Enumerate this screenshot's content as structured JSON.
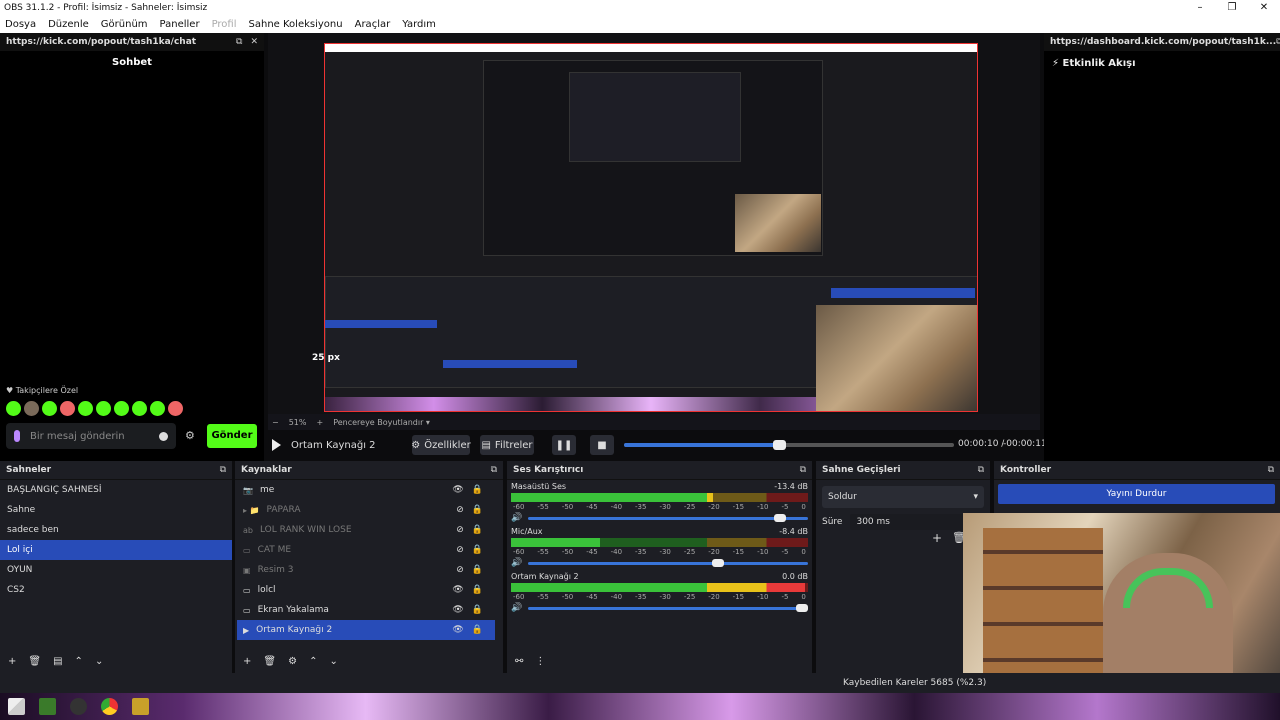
{
  "window": {
    "title": "OBS 31.1.2 - Profil: İsimsiz - Sahneler: İsimsiz"
  },
  "menu": [
    "Dosya",
    "Düzenle",
    "Görünüm",
    "Paneller",
    "Profil",
    "Sahne Koleksiyonu",
    "Araçlar",
    "Yardım"
  ],
  "chat_dock": {
    "url": "https://kick.com/popout/tash1ka/chat",
    "title": "Sohbet",
    "subs_label": "Takipçilere Özel",
    "input_placeholder": "Bir mesaj gönderin",
    "send_label": "Gönder"
  },
  "activity_dock": {
    "url": "https://dashboard.kick.com/popout/tash1k...",
    "title": "Etkinlik Akışı"
  },
  "preview": {
    "size_label": "25 px",
    "zoom": "51%",
    "fit_label": "Pencereye Boyutlandır"
  },
  "media": {
    "source_name": "Ortam Kaynağı 2",
    "properties_label": "Özellikler",
    "filters_label": "Filtreler",
    "progress": 0.47,
    "time_current": "00:00:10",
    "time_sep": "/",
    "time_remaining": "-00:00:11"
  },
  "scenes": {
    "title": "Sahneler",
    "items": [
      "BAŞLANGIÇ SAHNESİ",
      "Sahne",
      "sadece ben",
      "Lol içi",
      "OYUN",
      "CS2"
    ],
    "selected": 3
  },
  "sources": {
    "title": "Kaynaklar",
    "items": [
      {
        "name": "me",
        "icon": "camera-icon",
        "visible": true,
        "dim": false
      },
      {
        "name": "PAPARA",
        "icon": "folder-icon",
        "visible": false,
        "dim": true
      },
      {
        "name": "LOL RANK WIN LOSE",
        "icon": "text-icon",
        "visible": false,
        "dim": true
      },
      {
        "name": "CAT ME",
        "icon": "window-icon",
        "visible": false,
        "dim": true
      },
      {
        "name": "Resim 3",
        "icon": "image-icon",
        "visible": false,
        "dim": true
      },
      {
        "name": "lolcl",
        "icon": "window-icon",
        "visible": true,
        "dim": false
      },
      {
        "name": "Ekran Yakalama",
        "icon": "monitor-icon",
        "visible": true,
        "dim": false
      },
      {
        "name": "Ortam Kaynağı 2",
        "icon": "play-icon",
        "visible": true,
        "dim": false
      }
    ],
    "selected": 7
  },
  "mixer": {
    "title": "Ses Karıştırıcı",
    "ticks": [
      "-60",
      "-55",
      "-50",
      "-45",
      "-40",
      "-35",
      "-30",
      "-25",
      "-20",
      "-15",
      "-10",
      "-5",
      "0"
    ],
    "tracks": [
      {
        "name": "Masaüstü Ses",
        "db": "-13.4 dB",
        "level": 0.68,
        "volume": 0.92
      },
      {
        "name": "Mic/Aux",
        "db": "-8.4 dB",
        "level": 0.3,
        "volume": 0.7
      },
      {
        "name": "Ortam Kaynağı 2",
        "db": "0.0 dB",
        "level": 0.99,
        "volume": 1.0
      }
    ]
  },
  "transitions": {
    "title": "Sahne Geçişleri",
    "selected": "Soldur",
    "duration_label": "Süre",
    "duration_value": "300 ms"
  },
  "controls": {
    "title": "Kontroller",
    "stop_stream": "Yayını Durdur"
  },
  "status": {
    "dropped_frames": "Kaybedilen Kareler 5685 (%2.3)"
  }
}
